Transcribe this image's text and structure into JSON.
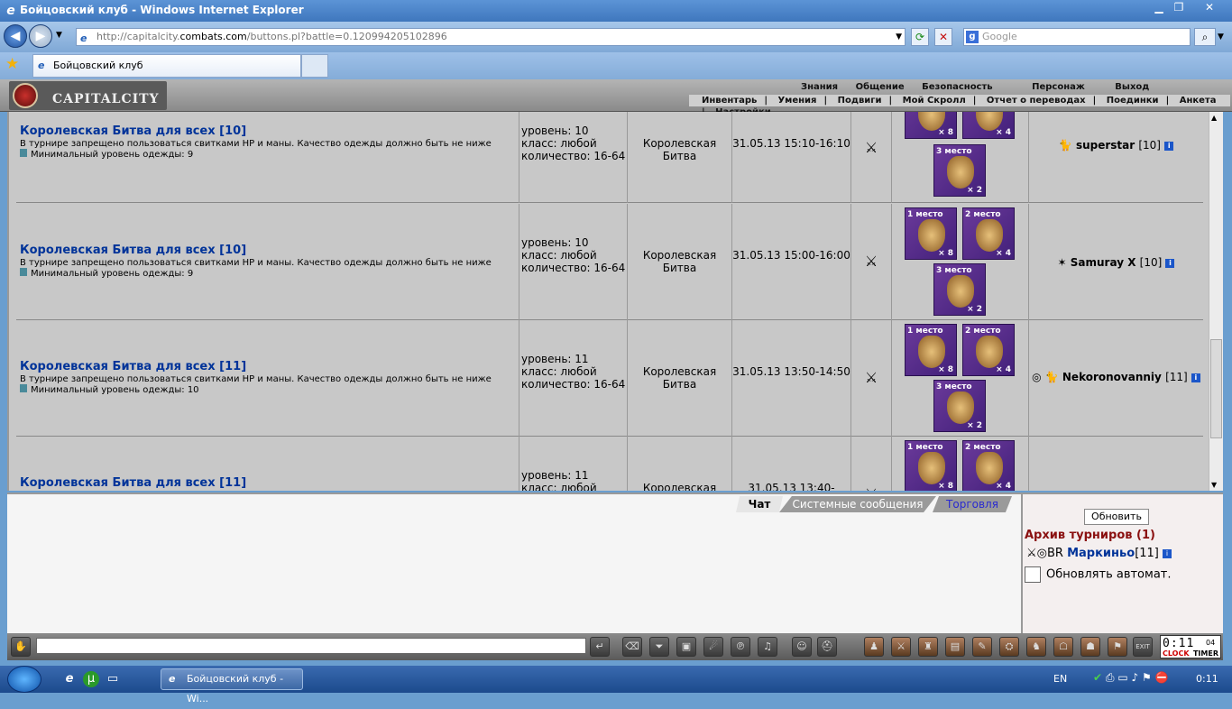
{
  "window": {
    "title": "Бойцовский клуб - Windows Internet Explorer"
  },
  "browser": {
    "url_prefix": "http://capitalcity.",
    "url_domain": "combats.com",
    "url_path": "/buttons.pl?battle=0.120994205102896",
    "search_placeholder": "Google",
    "tab_title": "Бойцовский клуб"
  },
  "game_header": {
    "logo_text": "CAPITALCITY",
    "top_menu": [
      "Знания",
      "Общение",
      "Безопасность",
      "Персонаж",
      "Выход"
    ],
    "sub_menu": [
      "Инвентарь",
      "|",
      "Умения",
      "|",
      "Подвиги",
      "|",
      "Мой Скролл",
      "|",
      "Отчет о переводах",
      "|",
      "Поединки",
      "|",
      "Анкета",
      "|",
      "Настройки"
    ]
  },
  "tournaments": [
    {
      "title": "Королевская Битва для всех [10]",
      "desc": "В турнире запрещено пользоваться свитками HP и маны. Качество одежды должно быть не ниже",
      "min_level": "Минимальный уровень одежды: 9",
      "level": "уровень: 10",
      "class": "класс: любой",
      "count": "количество: 16-64",
      "type": "Королевская Битва",
      "time": "31.05.13 15:10-16:10",
      "winner": "superstar",
      "winner_level": "[10]",
      "winner_icons": "🐈"
    },
    {
      "title": "Королевская Битва для всех [10]",
      "desc": "В турнире запрещено пользоваться свитками HP и маны. Качество одежды должно быть не ниже",
      "min_level": "Минимальный уровень одежды: 9",
      "level": "уровень: 10",
      "class": "класс: любой",
      "count": "количество: 16-64",
      "type": "Королевская Битва",
      "time": "31.05.13 15:00-16:00",
      "winner": "Samuray X",
      "winner_level": "[10]",
      "winner_icons": "✶"
    },
    {
      "title": "Королевская Битва для всех [11]",
      "desc": "В турнире запрещено пользоваться свитками HP и маны. Качество одежды должно быть не ниже",
      "min_level": "Минимальный уровень одежды: 10",
      "level": "уровень: 11",
      "class": "класс: любой",
      "count": "количество: 16-64",
      "type": "Королевская Битва",
      "time": "31.05.13 13:50-14:50",
      "winner": "Nekoronovanniy",
      "winner_level": "[11]",
      "winner_icons": "◎ 🐈"
    },
    {
      "title": "Королевская Битва для всех [11]",
      "desc": "",
      "min_level": "",
      "level": "уровень: 11",
      "class": "класс: любой",
      "count": "",
      "type": "Королевская",
      "time": "31.05.13 13:40-",
      "winner": "",
      "winner_level": "",
      "winner_icons": ""
    }
  ],
  "prizes": {
    "first": "1 место",
    "second": "2 место",
    "third": "3 место",
    "first_count": "× 8",
    "second_count": "× 4",
    "third_count": "× 2"
  },
  "chat": {
    "tabs": [
      "Чат",
      "Системные сообщения",
      "Торговля"
    ]
  },
  "side": {
    "refresh_label": "Обновить",
    "archive_label": "Архив турниров (1)",
    "archive_user": "Маркиньо",
    "archive_user_level": "[11]",
    "auto_refresh_label": "Обновлять автомат."
  },
  "clock": {
    "time": "0:11",
    "seconds": "04",
    "clock_label": "CLOCK",
    "timer_label": "TIMER",
    "exit_label": "EXIT"
  },
  "taskbar": {
    "task_title": "Бойцовский клуб - Wi...",
    "lang": "EN",
    "time": "0:11"
  },
  "info_icon": "i"
}
